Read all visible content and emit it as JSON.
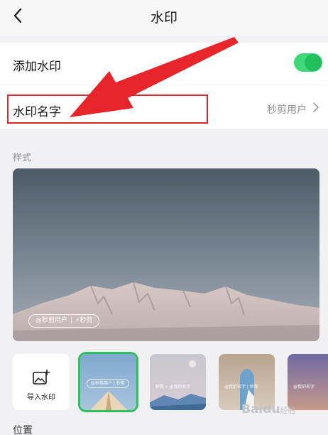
{
  "header": {
    "title": "水印"
  },
  "settings": {
    "add_watermark_label": "添加水印",
    "add_watermark_enabled": true,
    "watermark_name_label": "水印名字",
    "watermark_name_value": "秒剪用户"
  },
  "style_section": {
    "label": "样式",
    "preview_badge_user": "@秒剪用户",
    "preview_badge_app": "秒剪"
  },
  "templates": {
    "import_label": "导入水印",
    "items": [
      {
        "text": "@秒剪用户 | 秒剪",
        "selected": true
      },
      {
        "text": "秒剪 • @我的名字",
        "selected": false
      },
      {
        "text": "@我的名字 | 秒剪",
        "selected": false
      },
      {
        "text": "@我的名字",
        "selected": false
      }
    ]
  },
  "position_section": {
    "label": "位置"
  },
  "site_watermark": {
    "text": "Baidu",
    "sub": "经验"
  },
  "colors": {
    "accent": "#22bf5e",
    "annotation": "#d9262c"
  }
}
